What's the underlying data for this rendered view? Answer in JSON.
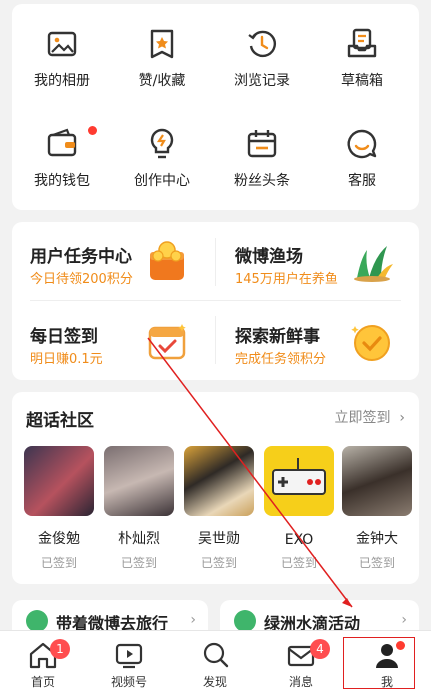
{
  "grid": [
    {
      "label": "我的相册",
      "icon": "photo-album-icon"
    },
    {
      "label": "赞/收藏",
      "icon": "like-collect-icon"
    },
    {
      "label": "浏览记录",
      "icon": "history-clock-icon"
    },
    {
      "label": "草稿箱",
      "icon": "drafts-icon"
    },
    {
      "label": "我的钱包",
      "icon": "wallet-icon"
    },
    {
      "label": "创作中心",
      "icon": "lightbulb-icon"
    },
    {
      "label": "粉丝头条",
      "icon": "calendar-icon"
    },
    {
      "label": "客服",
      "icon": "customer-service-icon"
    }
  ],
  "tasks": [
    {
      "title": "用户任务中心",
      "subtitle": "今日待领200积分",
      "icon": "coin-gift-icon"
    },
    {
      "title": "微博渔场",
      "subtitle": "145万用户在养鱼",
      "icon": "fishery-plant-icon"
    },
    {
      "title": "每日签到",
      "subtitle": "明日赚0.1元",
      "icon": "calendar-check-icon"
    },
    {
      "title": "探索新鲜事",
      "subtitle": "完成任务领积分",
      "icon": "check-medal-icon"
    }
  ],
  "topic": {
    "title": "超话社区",
    "more": "立即签到",
    "people": [
      {
        "name": "金俊勉",
        "status": "已签到"
      },
      {
        "name": "朴灿烈",
        "status": "已签到"
      },
      {
        "name": "吴世勋",
        "status": "已签到"
      },
      {
        "name": "EXO",
        "status": "已签到"
      },
      {
        "name": "金钟大",
        "status": "已签到"
      }
    ]
  },
  "mini_cards": [
    {
      "title": "带着微博去旅行"
    },
    {
      "title": "绿洲水滴活动"
    }
  ],
  "tabs": [
    {
      "label": "首页",
      "badge": "1"
    },
    {
      "label": "视频号",
      "badge": ""
    },
    {
      "label": "发现",
      "badge": ""
    },
    {
      "label": "消息",
      "badge": "4"
    },
    {
      "label": "我",
      "badge": ""
    }
  ],
  "colors": {
    "accent": "#f08c1a",
    "badge": "#ff4d4f",
    "annotation": "#e02020"
  }
}
